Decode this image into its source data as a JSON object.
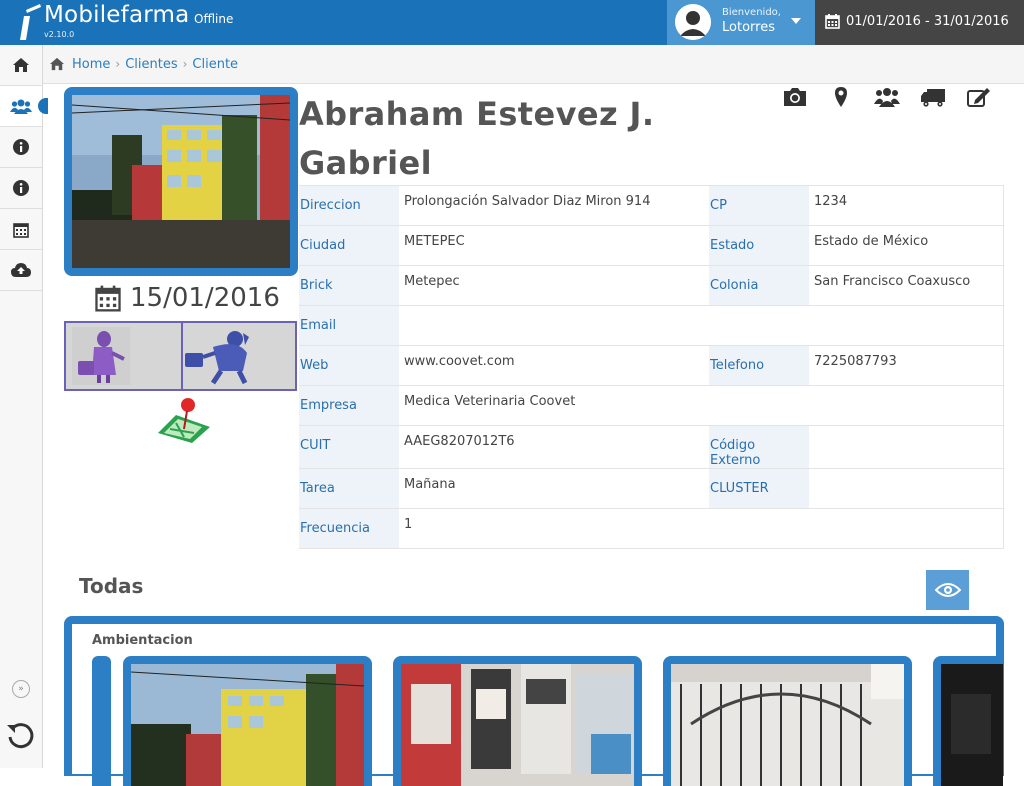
{
  "app": {
    "name": "Mobilefarma",
    "status": "Offline",
    "version": "v2.10.0"
  },
  "user": {
    "welcome": "Bienvenido,",
    "name": "Lotorres"
  },
  "date_range": "01/01/2016 - 31/01/2016",
  "breadcrumb": [
    "Home",
    "Clientes",
    "Cliente"
  ],
  "sidebar": {
    "items": [
      {
        "icon": "home-icon"
      },
      {
        "icon": "users-icon",
        "active": true
      },
      {
        "icon": "info-icon"
      },
      {
        "icon": "info-icon"
      },
      {
        "icon": "calendar-icon"
      },
      {
        "icon": "cloud-upload-icon"
      }
    ]
  },
  "client": {
    "name_line1": "Abraham Estevez J.",
    "name_line2": "Gabriel",
    "date": "15/01/2016",
    "fields": {
      "direccion_label": "Direccion",
      "direccion": "Prolongación Salvador Diaz Miron 914",
      "cp_label": "CP",
      "cp": "1234",
      "ciudad_label": "Ciudad",
      "ciudad": "METEPEC",
      "estado_label": "Estado",
      "estado": "Estado de México",
      "brick_label": "Brick",
      "brick": "Metepec",
      "colonia_label": "Colonia",
      "colonia": "San Francisco Coaxusco",
      "email_label": "Email",
      "email": "",
      "web_label": "Web",
      "web": "www.coovet.com",
      "telefono_label": "Telefono",
      "telefono": "7225087793",
      "empresa_label": "Empresa",
      "empresa": "Medica Veterinaria Coovet",
      "cuit_label": "CUIT",
      "cuit": "AAEG8207012T6",
      "codigo_label": "Código Externo",
      "codigo": "",
      "tarea_label": "Tarea",
      "tarea": "Mañana",
      "cluster_label": "CLUSTER",
      "cluster": "",
      "frecuencia_label": "Frecuencia",
      "frecuencia": "1"
    }
  },
  "actions": [
    "camera-icon",
    "map-marker-icon",
    "group-icon",
    "truck-icon",
    "edit-icon"
  ],
  "gallery": {
    "heading": "Todas",
    "section_title": "Ambientacion"
  },
  "colors": {
    "primary": "#1a73b8",
    "accent": "#2c7fc4",
    "dark": "#454545",
    "purple": "#6a62b8"
  }
}
